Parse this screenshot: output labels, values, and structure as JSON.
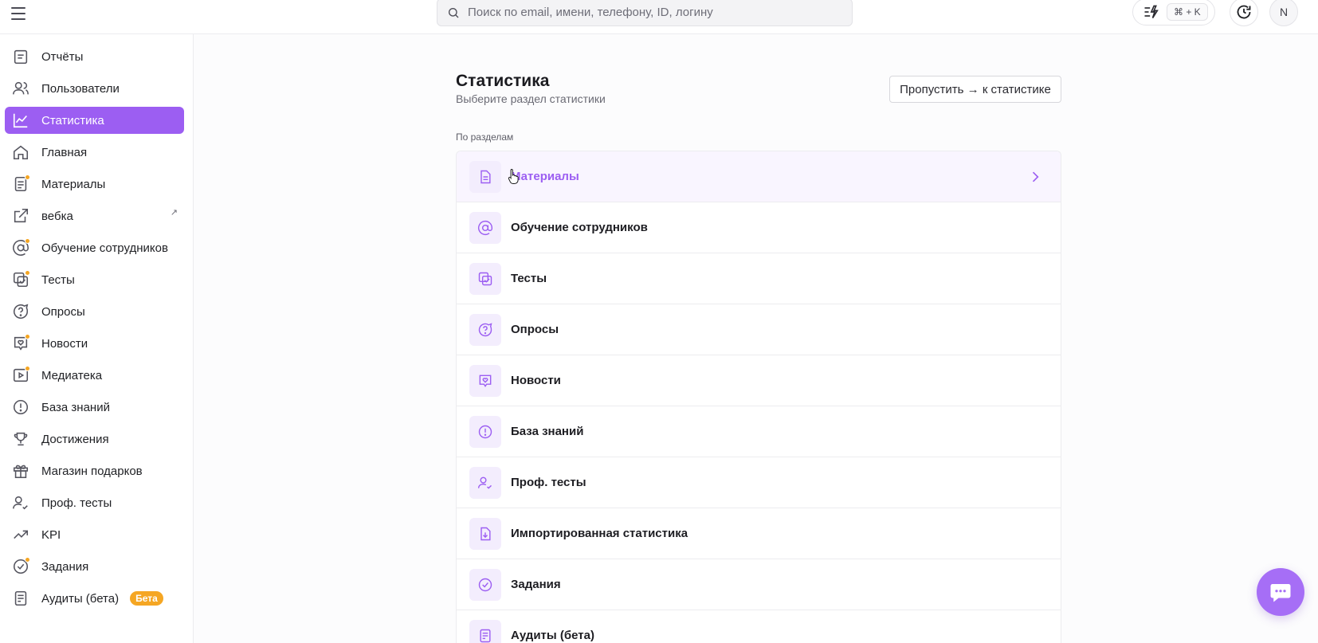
{
  "topbar": {
    "search_placeholder": "Поиск по email, имени, телефону, ID, логину",
    "shortcut": "⌘ + K",
    "avatar_initial": "N"
  },
  "sidebar": {
    "items": [
      {
        "label": "Отчёты",
        "icon": "report-icon"
      },
      {
        "label": "Пользователи",
        "icon": "users-icon"
      },
      {
        "label": "Статистика",
        "icon": "chart-icon",
        "active": true
      },
      {
        "label": "Главная",
        "icon": "home-icon"
      },
      {
        "label": "Материалы",
        "icon": "document-icon",
        "dot": true
      },
      {
        "label": "вебка",
        "icon": "external-link-icon",
        "external": true
      },
      {
        "label": "Обучение сотрудников",
        "icon": "at-sign-icon",
        "dot": true
      },
      {
        "label": "Тесты",
        "icon": "test-icon",
        "dot": true
      },
      {
        "label": "Опросы",
        "icon": "question-bubble-icon"
      },
      {
        "label": "Новости",
        "icon": "news-icon",
        "dot": true
      },
      {
        "label": "Медиатека",
        "icon": "media-icon",
        "dot": true
      },
      {
        "label": "База знаний",
        "icon": "info-circle-icon"
      },
      {
        "label": "Достижения",
        "icon": "trophy-icon"
      },
      {
        "label": "Магазин подарков",
        "icon": "gift-icon"
      },
      {
        "label": "Проф. тесты",
        "icon": "user-check-icon"
      },
      {
        "label": "KPI",
        "icon": "trend-up-icon"
      },
      {
        "label": "Задания",
        "icon": "check-circle-icon",
        "dot": true
      },
      {
        "label": "Аудиты (бета)",
        "icon": "audit-icon",
        "badge": "Бета"
      }
    ]
  },
  "main": {
    "title": "Статистика",
    "subtitle": "Выберите раздел статистики",
    "skip_button": "Пропустить → к статистике",
    "section_label": "По разделам",
    "rows": [
      {
        "label": "Материалы",
        "icon": "document-icon"
      },
      {
        "label": "Обучение сотрудников",
        "icon": "at-sign-icon"
      },
      {
        "label": "Тесты",
        "icon": "test-icon"
      },
      {
        "label": "Опросы",
        "icon": "question-bubble-icon"
      },
      {
        "label": "Новости",
        "icon": "news-icon"
      },
      {
        "label": "База знаний",
        "icon": "info-circle-icon"
      },
      {
        "label": "Проф. тесты",
        "icon": "user-check-icon"
      },
      {
        "label": "Импортированная статистика",
        "icon": "import-icon"
      },
      {
        "label": "Задания",
        "icon": "check-circle-icon"
      },
      {
        "label": "Аудиты (бета)",
        "icon": "audit-icon"
      }
    ]
  },
  "colors": {
    "accent": "#9c5ef2",
    "badge": "#f5a623",
    "tile": "#f3edfd"
  }
}
